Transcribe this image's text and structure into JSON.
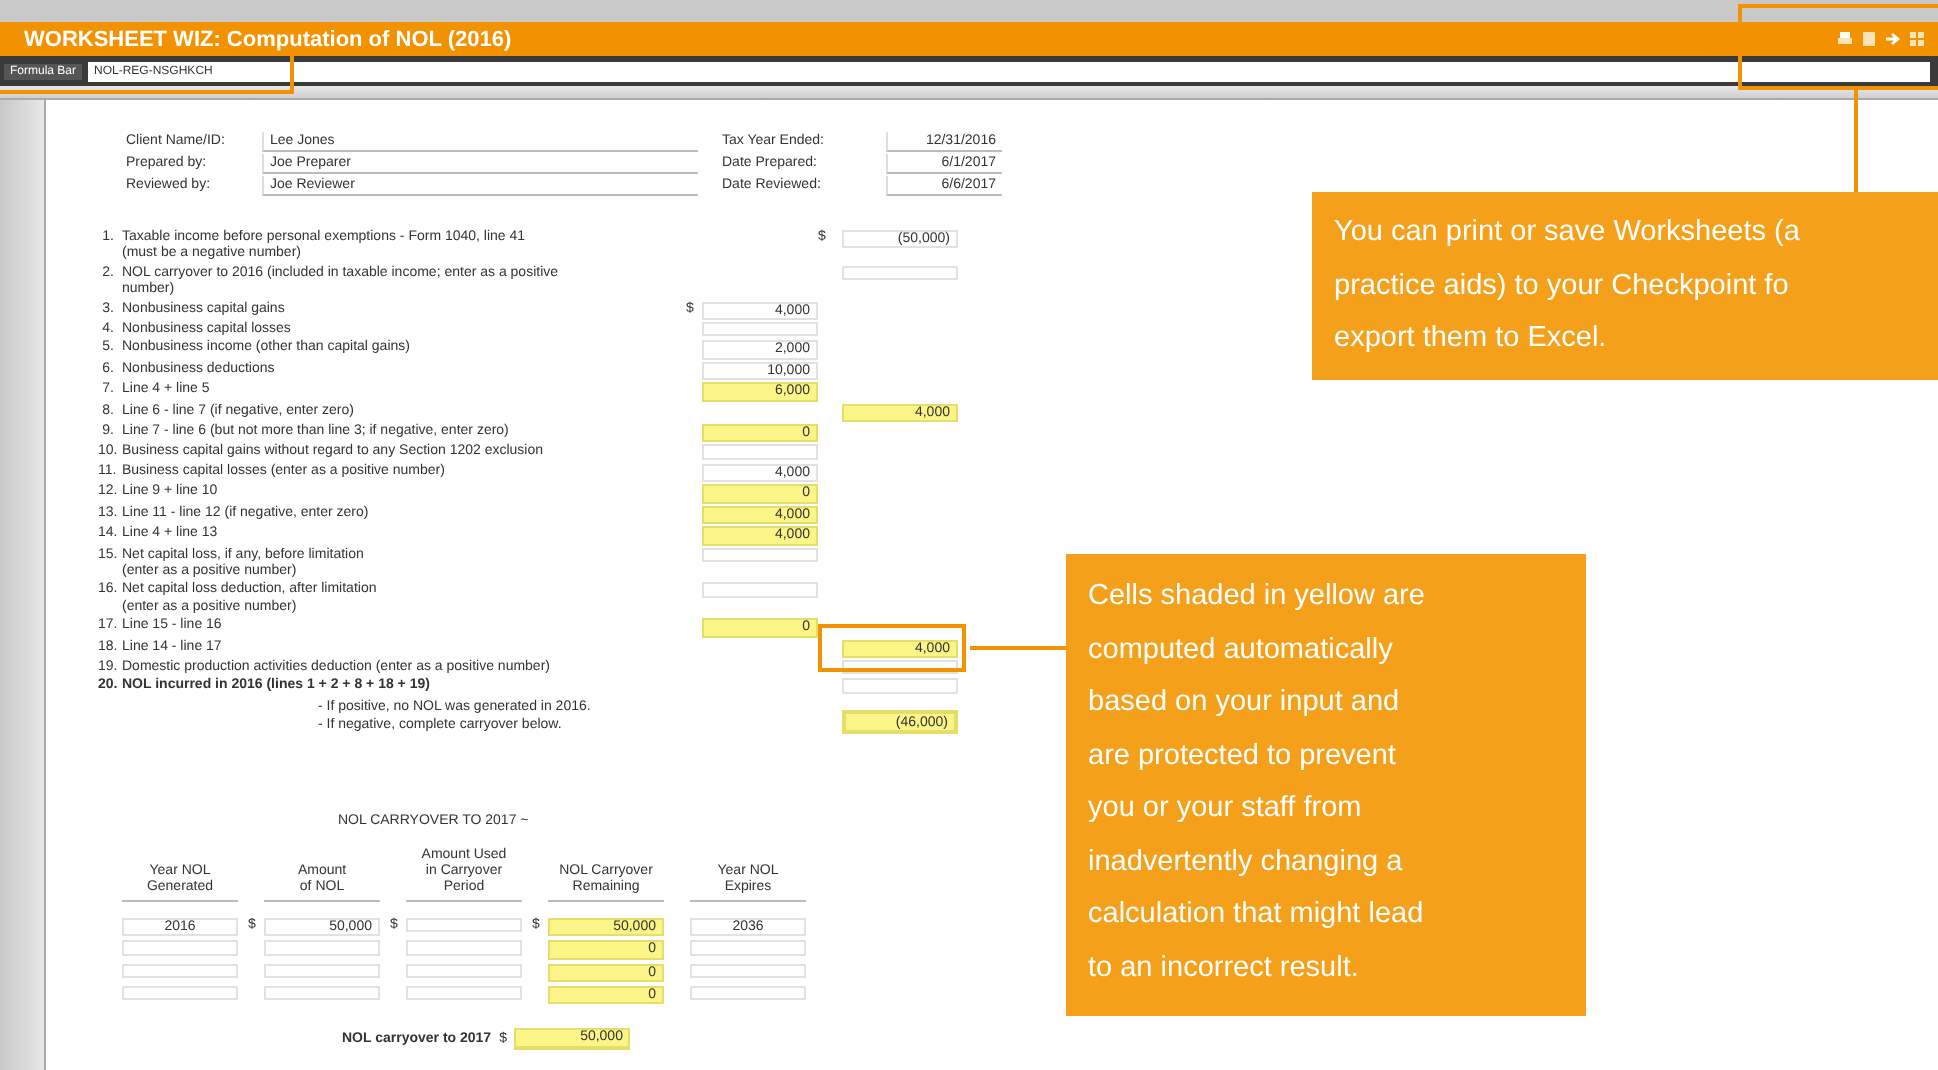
{
  "window": {
    "title": "WORKSHEET WIZ: Computation of NOL (2016)"
  },
  "formula_bar": {
    "label": "Formula Bar",
    "value": "NOL-REG-NSGHKCH"
  },
  "header_fields": [
    {
      "label": "Client Name/ID:",
      "value": "Lee Jones",
      "right_label": "Tax Year Ended:",
      "right_value": "12/31/2016"
    },
    {
      "label": "Prepared by:",
      "value": "Joe Preparer",
      "right_label": "Date Prepared:",
      "right_value": "6/1/2017"
    },
    {
      "label": "Reviewed by:",
      "value": "Joe Reviewer",
      "right_label": "Date Reviewed:",
      "right_value": "6/6/2017"
    }
  ],
  "lines": [
    {
      "num": "1.",
      "text": "Taxable income before personal exemptions - Form 1040, line 41\n(must be a negative number)",
      "kind": "outer",
      "dollar": "$",
      "value": "(50,000)",
      "computed": false,
      "bold": false
    },
    {
      "num": "2.",
      "text": "NOL carryover to 2016 (included in taxable income; enter as a positive\nnumber)",
      "kind": "outer",
      "computed": false,
      "bold": false
    },
    {
      "num": "3.",
      "text": "Nonbusiness capital gains",
      "kind": "inner",
      "dollar": "$",
      "value": "4,000",
      "computed": false,
      "bold": false
    },
    {
      "num": "4.",
      "text": "Nonbusiness capital losses",
      "kind": "inner",
      "computed": false,
      "bold": false
    },
    {
      "num": "5.",
      "text": "Nonbusiness income (other than capital gains)",
      "kind": "inner",
      "value": "2,000",
      "computed": false,
      "bold": false
    },
    {
      "num": "6.",
      "text": "Nonbusiness deductions",
      "kind": "inner",
      "value": "10,000",
      "computed": false,
      "bold": false
    },
    {
      "num": "7.",
      "text": "Line 4 + line 5",
      "kind": "inner",
      "value": "6,000",
      "computed": true,
      "bold": false
    },
    {
      "num": "8.",
      "text": "Line 6 - line 7 (if negative, enter zero)",
      "kind": "outer",
      "value": "4,000",
      "computed": true,
      "bold": false
    },
    {
      "num": "9.",
      "text": "Line 7 - line 6 (but not more than line 3; if negative, enter zero)",
      "kind": "inner",
      "value": "0",
      "computed": true,
      "bold": false
    },
    {
      "num": "10.",
      "text": "Business capital gains without regard to any Section 1202 exclusion",
      "kind": "inner",
      "computed": false,
      "bold": false
    },
    {
      "num": "11.",
      "text": "Business capital losses (enter as a positive number)",
      "kind": "inner",
      "value": "4,000",
      "computed": false,
      "bold": false
    },
    {
      "num": "12.",
      "text": "Line 9 + line 10",
      "kind": "inner",
      "value": "0",
      "computed": true,
      "bold": false
    },
    {
      "num": "13.",
      "text": "Line 11 - line 12 (if negative, enter zero)",
      "kind": "inner",
      "value": "4,000",
      "computed": true,
      "bold": false
    },
    {
      "num": "14.",
      "text": "Line 4 + line 13",
      "kind": "inner",
      "value": "4,000",
      "computed": true,
      "bold": false
    },
    {
      "num": "15.",
      "text": "Net capital loss, if any, before limitation\n(enter as a positive number)",
      "kind": "inner",
      "computed": false,
      "bold": false
    },
    {
      "num": "16.",
      "text": "Net capital loss deduction, after limitation\n(enter as a positive number)",
      "kind": "inner",
      "computed": false,
      "bold": false
    },
    {
      "num": "17.",
      "text": "Line 15 - line 16",
      "kind": "inner",
      "value": "0",
      "computed": true,
      "bold": false
    },
    {
      "num": "18.",
      "text": "Line 14 - line 17",
      "kind": "outer",
      "value": "4,000",
      "computed": true,
      "bold": false
    },
    {
      "num": "19.",
      "text": "Domestic production activities deduction (enter as a positive number)",
      "kind": "outer",
      "computed": false,
      "bold": false
    },
    {
      "num": "20.",
      "text": "NOL incurred in 2016 (lines 1 + 2 + 8 + 18 + 19)",
      "kind": "outer",
      "computed": false,
      "bold": true
    }
  ],
  "notes": [
    {
      "text": "- If positive, no NOL was generated in 2016."
    },
    {
      "text": "- If negative, complete carryover below."
    }
  ],
  "nol_total": {
    "value": "(46,000)"
  },
  "carryover": {
    "heading": "NOL CARRYOVER TO 2017 ~",
    "columns": [
      "Year NOL\nGenerated",
      "Amount\nof NOL",
      "Amount Used\nin Carryover\nPeriod",
      "NOL Carryover\nRemaining",
      "Year NOL\nExpires"
    ],
    "rows": [
      [
        {
          "value": "2016"
        },
        {
          "dollar": "$",
          "value": "50,000"
        },
        {
          "dollar": "$"
        },
        {
          "dollar": "$",
          "value": "50,000"
        },
        {
          "value": "2036"
        }
      ],
      [
        {},
        {},
        {},
        {
          "value": "0"
        },
        {}
      ],
      [
        {},
        {},
        {},
        {
          "value": "0"
        },
        {}
      ],
      [
        {},
        {},
        {},
        {
          "value": "0"
        },
        {}
      ]
    ],
    "total_label": "NOL carryover to 2017",
    "total_dollar": "$",
    "total_value": "50,000"
  },
  "callouts": [
    {
      "text": "You can print or save Worksheets (a\npractice aids) to your Checkpoint fo\nexport them to Excel."
    },
    {
      "text": "Cells shaded in yellow are\ncomputed automatically\nbased on your input and\nare protected to prevent\nyou or your staff from\ninadvertently changing a\ncalculation that might lead\nto an incorrect result."
    }
  ]
}
